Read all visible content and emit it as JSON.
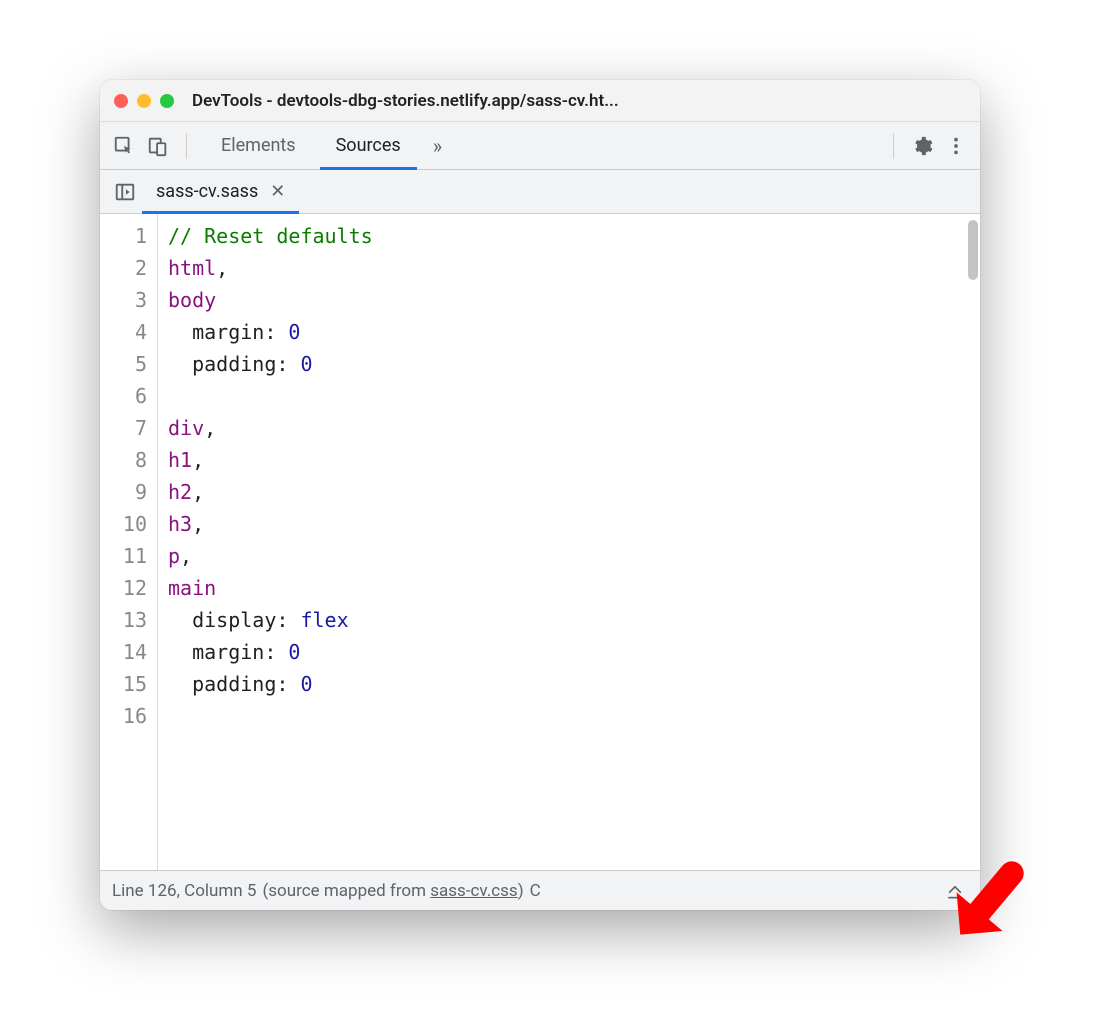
{
  "window": {
    "title": "DevTools - devtools-dbg-stories.netlify.app/sass-cv.ht..."
  },
  "toolbar": {
    "tabs": [
      {
        "label": "Elements",
        "active": false
      },
      {
        "label": "Sources",
        "active": true
      }
    ]
  },
  "filebar": {
    "tab": {
      "label": "sass-cv.sass"
    }
  },
  "code": {
    "lines": [
      {
        "n": "1",
        "segs": [
          {
            "t": "// Reset defaults",
            "c": "tok-comment"
          }
        ]
      },
      {
        "n": "2",
        "segs": [
          {
            "t": "html",
            "c": "tok-tag"
          },
          {
            "t": ",",
            "c": "tok-punct"
          }
        ]
      },
      {
        "n": "3",
        "segs": [
          {
            "t": "body",
            "c": "tok-tag"
          }
        ]
      },
      {
        "n": "4",
        "segs": [
          {
            "t": "  margin",
            "c": "tok-prop"
          },
          {
            "t": ": ",
            "c": "tok-punct"
          },
          {
            "t": "0",
            "c": "tok-val"
          }
        ]
      },
      {
        "n": "5",
        "segs": [
          {
            "t": "  padding",
            "c": "tok-prop"
          },
          {
            "t": ": ",
            "c": "tok-punct"
          },
          {
            "t": "0",
            "c": "tok-val"
          }
        ]
      },
      {
        "n": "6",
        "segs": [
          {
            "t": "",
            "c": ""
          }
        ]
      },
      {
        "n": "7",
        "segs": [
          {
            "t": "div",
            "c": "tok-tag"
          },
          {
            "t": ",",
            "c": "tok-punct"
          }
        ]
      },
      {
        "n": "8",
        "segs": [
          {
            "t": "h1",
            "c": "tok-tag"
          },
          {
            "t": ",",
            "c": "tok-punct"
          }
        ]
      },
      {
        "n": "9",
        "segs": [
          {
            "t": "h2",
            "c": "tok-tag"
          },
          {
            "t": ",",
            "c": "tok-punct"
          }
        ]
      },
      {
        "n": "10",
        "segs": [
          {
            "t": "h3",
            "c": "tok-tag"
          },
          {
            "t": ",",
            "c": "tok-punct"
          }
        ]
      },
      {
        "n": "11",
        "segs": [
          {
            "t": "p",
            "c": "tok-tag"
          },
          {
            "t": ",",
            "c": "tok-punct"
          }
        ]
      },
      {
        "n": "12",
        "segs": [
          {
            "t": "main",
            "c": "tok-tag"
          }
        ]
      },
      {
        "n": "13",
        "segs": [
          {
            "t": "  display",
            "c": "tok-prop"
          },
          {
            "t": ": ",
            "c": "tok-punct"
          },
          {
            "t": "flex",
            "c": "tok-val"
          }
        ]
      },
      {
        "n": "14",
        "segs": [
          {
            "t": "  margin",
            "c": "tok-prop"
          },
          {
            "t": ": ",
            "c": "tok-punct"
          },
          {
            "t": "0",
            "c": "tok-val"
          }
        ]
      },
      {
        "n": "15",
        "segs": [
          {
            "t": "  padding",
            "c": "tok-prop"
          },
          {
            "t": ": ",
            "c": "tok-punct"
          },
          {
            "t": "0",
            "c": "tok-val"
          }
        ]
      },
      {
        "n": "16",
        "segs": [
          {
            "t": "",
            "c": ""
          }
        ]
      }
    ]
  },
  "status": {
    "pos": "Line 126, Column 5",
    "mapped_prefix": "(source mapped from ",
    "mapped_link": "sass-cv.css",
    "mapped_suffix": ")",
    "trail": " C"
  }
}
